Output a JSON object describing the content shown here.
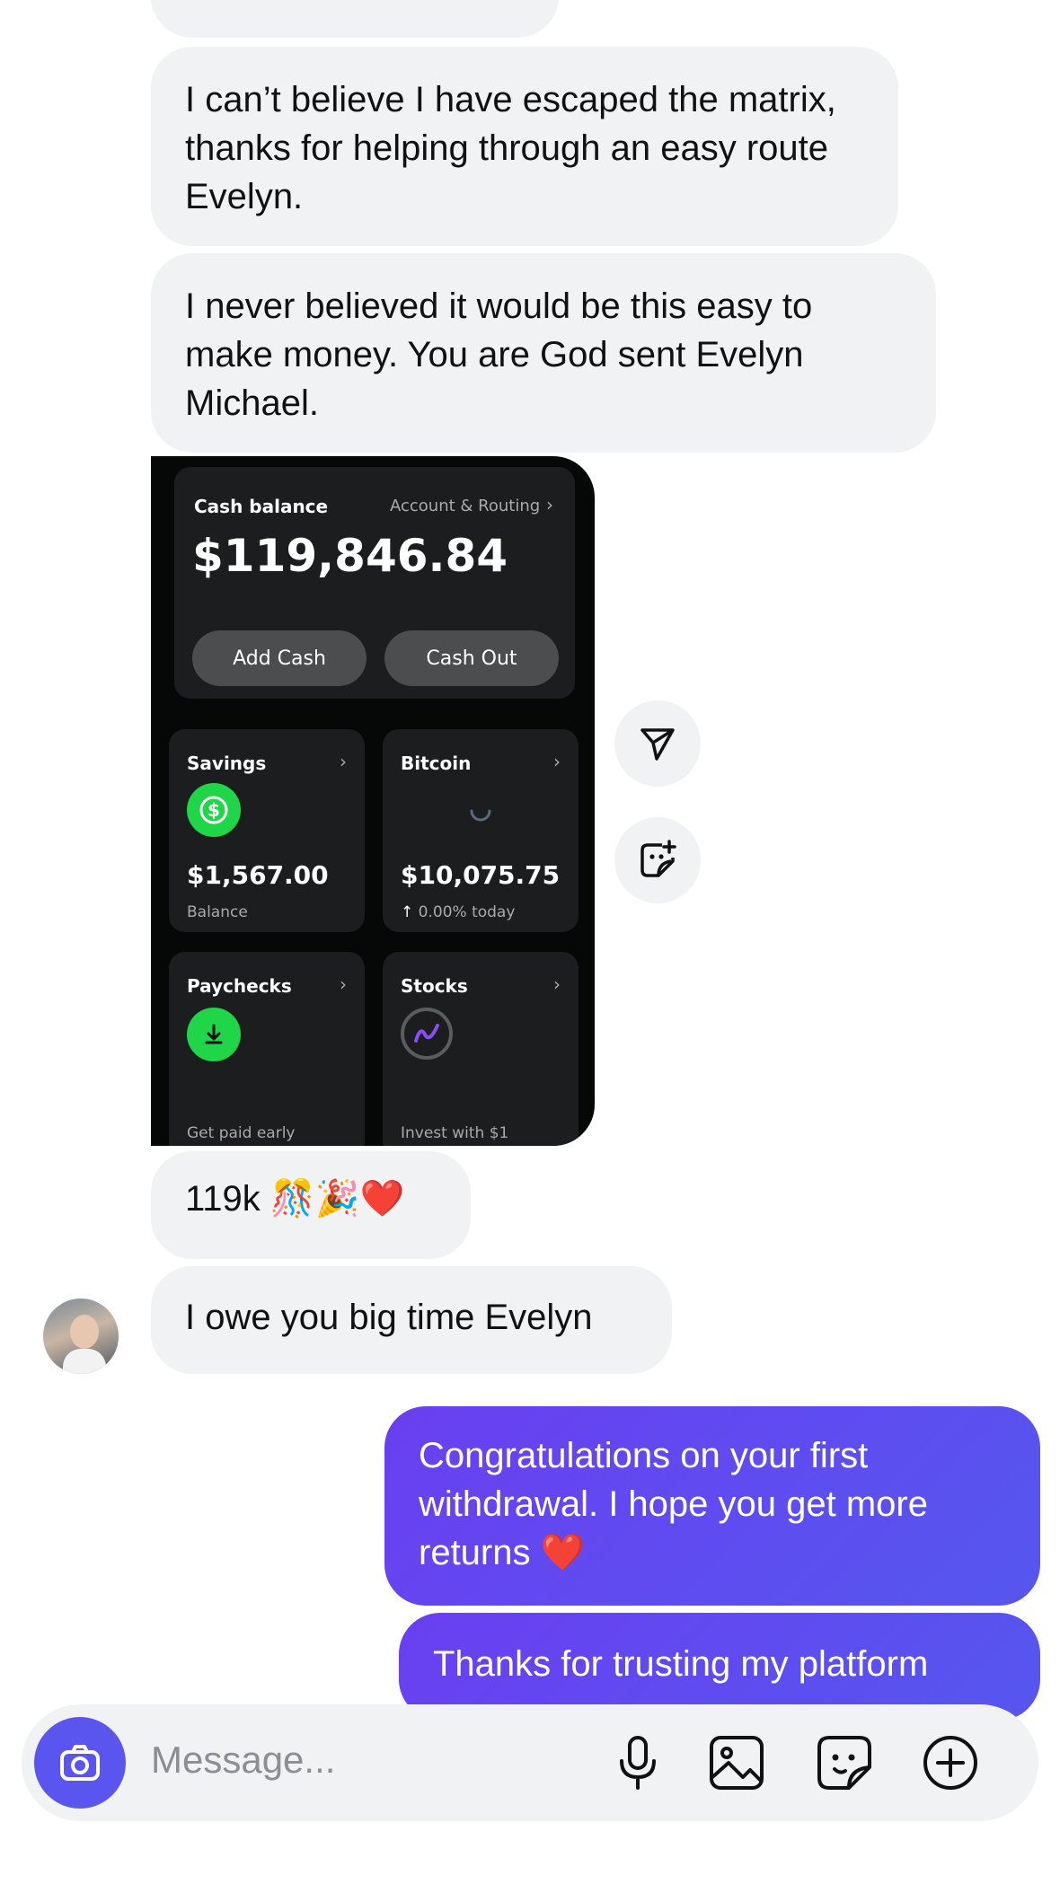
{
  "messages": {
    "m1": "I can’t believe I have escaped the matrix, thanks for helping through an easy route Evelyn.",
    "m2": "I never believed it would be this easy to make money. You are God sent Evelyn Michael.",
    "m3": "119k 🎊🎉❤️",
    "m4": "I owe you big time Evelyn",
    "o1": "Congratulations on your first withdrawal. I hope you get more returns ❤️",
    "o2": "Thanks for trusting my platform"
  },
  "cash_app": {
    "cash_balance_label": "Cash balance",
    "account_routing": "Account & Routing",
    "balance": "$119,846.84",
    "add_cash": "Add Cash",
    "cash_out": "Cash Out",
    "savings": {
      "title": "Savings",
      "amount": "$1,567.00",
      "sub": "Balance"
    },
    "bitcoin": {
      "title": "Bitcoin",
      "amount": "$10,075.75",
      "sub": "0.00% today"
    },
    "paychecks": {
      "title": "Paychecks",
      "sub": "Get paid early"
    },
    "stocks": {
      "title": "Stocks",
      "sub": "Invest with $1"
    }
  },
  "composer": {
    "placeholder": "Message..."
  },
  "colors": {
    "accent": "#5b55ef",
    "bubble_in": "#f1f2f4",
    "cash_green": "#1ed648"
  },
  "icons": [
    "send-icon",
    "sticker-icon",
    "camera-icon",
    "microphone-icon",
    "gallery-icon",
    "sticker-icon",
    "plus-circle-icon",
    "dollar-icon",
    "download-icon",
    "stocks-icon",
    "arrow-up-icon",
    "chevron-right-icon"
  ]
}
